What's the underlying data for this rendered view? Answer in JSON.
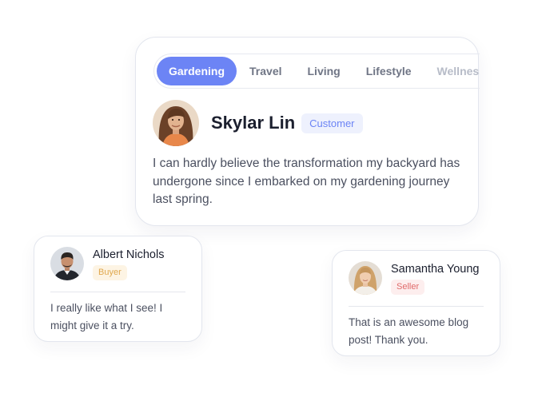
{
  "tabs": [
    {
      "label": "Gardening",
      "active": true
    },
    {
      "label": "Travel",
      "active": false
    },
    {
      "label": "Living",
      "active": false
    },
    {
      "label": "Lifestyle",
      "active": false
    },
    {
      "label": "Wellness",
      "active": false
    }
  ],
  "featured": {
    "name": "Skylar Lin",
    "badge": "Customer",
    "quote": "I can hardly believe the transformation my backyard has undergone since I embarked on my gardening journey last spring."
  },
  "reviews": [
    {
      "name": "Albert Nichols",
      "badge": "Buyer",
      "quote": "I really like what I see! I might give it a try."
    },
    {
      "name": "Samantha Young",
      "badge": "Seller",
      "quote": "That is an awesome blog post! Thank you."
    }
  ],
  "colors": {
    "accent": "#6c84f5",
    "buyer": "#e0a84e",
    "seller": "#e06a6a"
  }
}
